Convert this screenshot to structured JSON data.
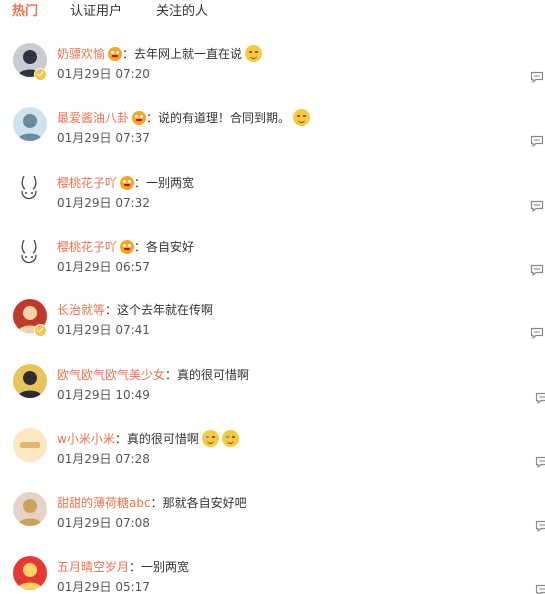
{
  "tabs": [
    {
      "label": "热门",
      "active": true
    },
    {
      "label": "认证用户",
      "active": false
    },
    {
      "label": "关注的人",
      "active": false
    }
  ],
  "comments": [
    {
      "user": "奶骠欢愉",
      "text": "去年网上就一直在说",
      "time": "01月29日 07:20",
      "verified": true,
      "vip": true,
      "emoji": 1
    },
    {
      "user": "最爱酱油八卦",
      "text": "说的有道理！合同到期。",
      "time": "01月29日 07:37",
      "verified": false,
      "vip": true,
      "emoji": 1
    },
    {
      "user": "樱桃花子吖",
      "text": "一别两宽",
      "time": "01月29日 07:32",
      "verified": false,
      "vip": true,
      "emoji": 0
    },
    {
      "user": "樱桃花子吖",
      "text": "各自安好",
      "time": "01月29日 06:57",
      "verified": false,
      "vip": true,
      "emoji": 0
    },
    {
      "user": "长治就等",
      "text": "这个去年就在传啊",
      "time": "01月29日 07:41",
      "verified": true,
      "vip": false,
      "emoji": 0
    },
    {
      "user": "欧气欧气欧气美少女",
      "text": "真的很可惜啊",
      "time": "01月29日 10:49",
      "verified": false,
      "vip": false,
      "emoji": 0
    },
    {
      "user": "w小米小米",
      "text": "真的很可惜啊",
      "time": "01月29日 07:28",
      "verified": false,
      "vip": false,
      "emoji": 2
    },
    {
      "user": "甜甜的薄荷糖abc",
      "text": "那就各自安好吧",
      "time": "01月29日 07:08",
      "verified": false,
      "vip": false,
      "emoji": 0
    },
    {
      "user": "五月晴空岁月",
      "text": "一别两宽",
      "time": "01月29日 05:17",
      "verified": false,
      "vip": false,
      "emoji": 0
    }
  ],
  "colors": {
    "accent": "#eb7350",
    "text": "#333333",
    "time": "#555555",
    "icon": "#8a8a8a"
  },
  "icons": {
    "reply": "comment-bubble-icon",
    "vip": "crown-face-icon",
    "verified": "gold-check-badge-icon"
  }
}
